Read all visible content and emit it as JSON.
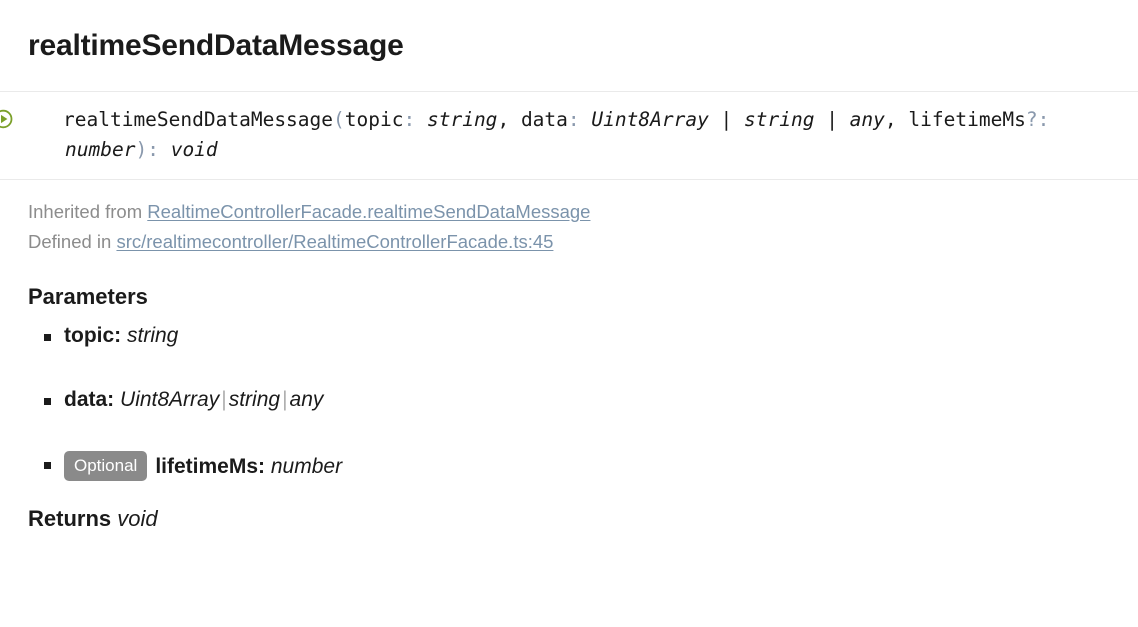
{
  "page": {
    "title": "realtimeSendDataMessage"
  },
  "signature": {
    "icon": "method-play-icon",
    "name": "realtimeSendDataMessage",
    "open_paren": "(",
    "close_paren": ")",
    "params": [
      {
        "name": "topic",
        "colon": ":",
        "optional_mark": "",
        "type": "string",
        "trailing": ","
      },
      {
        "name": "data",
        "colon": ":",
        "optional_mark": "",
        "type": "Uint8Array | string | any",
        "trailing": ","
      },
      {
        "name": "lifetimeMs",
        "colon": ":",
        "optional_mark": "?",
        "type": "number",
        "trailing": ""
      }
    ],
    "return_colon": ":",
    "return_type": "void",
    "union_separator": "|",
    "line1": "realtimeSendDataMessage(topic: string, data: Uint8Array | string | any,",
    "line2": "lifetimeMs?: number): void"
  },
  "meta": {
    "inherited_label": "Inherited from",
    "inherited_link": "RealtimeControllerFacade.realtimeSendDataMessage",
    "defined_label": "Defined in",
    "defined_link": "src/realtimecontroller/RealtimeControllerFacade.ts:45"
  },
  "parameters": {
    "heading": "Parameters",
    "items": [
      {
        "badge": "",
        "name": "topic:",
        "type_parts": [
          "string"
        ]
      },
      {
        "badge": "",
        "name": "data:",
        "type_parts": [
          "Uint8Array",
          "string",
          "any"
        ]
      },
      {
        "badge": "Optional",
        "name": "lifetimeMs:",
        "type_parts": [
          "number"
        ]
      }
    ],
    "union_separator": "|"
  },
  "returns": {
    "heading": "Returns",
    "type": "void"
  },
  "colors": {
    "icon_green": "#799b33",
    "link": "#7b93ab",
    "muted": "#8c8c8c",
    "badge_bg": "#8a8a8a",
    "divider": "#eaeaea",
    "punct": "#8a99ad",
    "text": "#1b1b1b"
  }
}
